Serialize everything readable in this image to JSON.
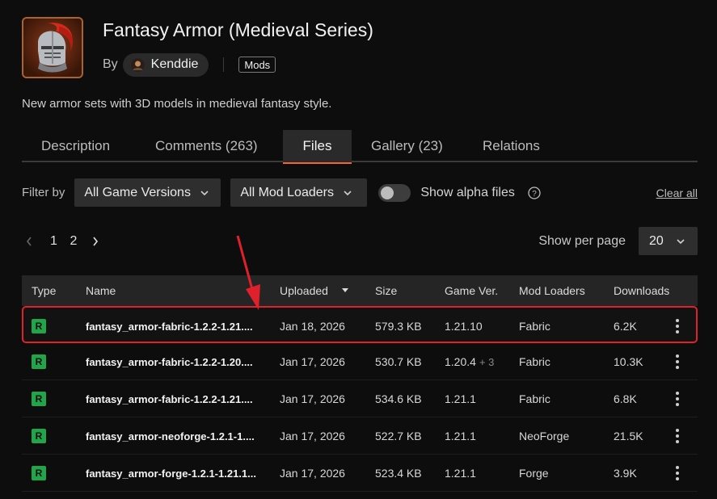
{
  "project": {
    "title": "Fantasy Armor (Medieval Series)",
    "by_label": "By",
    "author": "Kenddie",
    "tag": "Mods",
    "summary": "New armor sets with 3D models in medieval fantasy style."
  },
  "tabs": [
    {
      "label": "Description",
      "active": false
    },
    {
      "label": "Comments (263)",
      "active": false
    },
    {
      "label": "Files",
      "active": true
    },
    {
      "label": "Gallery (23)",
      "active": false
    },
    {
      "label": "Relations",
      "active": false
    }
  ],
  "filters": {
    "label": "Filter by",
    "game_versions": "All Game Versions",
    "mod_loaders": "All Mod Loaders",
    "alpha_label": "Show alpha files",
    "alpha_enabled": false,
    "clear_all": "Clear all"
  },
  "pagination": {
    "pages": [
      "1",
      "2"
    ],
    "current": "1",
    "per_page_label": "Show per page",
    "per_page_value": "20"
  },
  "table": {
    "headers": {
      "type": "Type",
      "name": "Name",
      "uploaded": "Uploaded",
      "size": "Size",
      "game_ver": "Game Ver.",
      "mod_loaders": "Mod Loaders",
      "downloads": "Downloads"
    },
    "rows": [
      {
        "type": "R",
        "name": "fantasy_armor-fabric-1.2.2-1.21....",
        "uploaded": "Jan 18, 2026",
        "size": "579.3 KB",
        "game_ver": "1.21.10",
        "game_ver_more": "",
        "loader": "Fabric",
        "downloads": "6.2K",
        "highlighted": true
      },
      {
        "type": "R",
        "name": "fantasy_armor-fabric-1.2.2-1.20....",
        "uploaded": "Jan 17, 2026",
        "size": "530.7 KB",
        "game_ver": "1.20.4",
        "game_ver_more": "+ 3",
        "loader": "Fabric",
        "downloads": "10.3K",
        "highlighted": false
      },
      {
        "type": "R",
        "name": "fantasy_armor-fabric-1.2.2-1.21....",
        "uploaded": "Jan 17, 2026",
        "size": "534.6 KB",
        "game_ver": "1.21.1",
        "game_ver_more": "",
        "loader": "Fabric",
        "downloads": "6.8K",
        "highlighted": false
      },
      {
        "type": "R",
        "name": "fantasy_armor-neoforge-1.2.1-1....",
        "uploaded": "Jan 17, 2026",
        "size": "522.7 KB",
        "game_ver": "1.21.1",
        "game_ver_more": "",
        "loader": "NeoForge",
        "downloads": "21.5K",
        "highlighted": false
      },
      {
        "type": "R",
        "name": "fantasy_armor-forge-1.2.1-1.21.1...",
        "uploaded": "Jan 17, 2026",
        "size": "523.4 KB",
        "game_ver": "1.21.1",
        "game_ver_more": "",
        "loader": "Forge",
        "downloads": "3.9K",
        "highlighted": false
      }
    ]
  },
  "colors": {
    "accent": "#f16436",
    "release_badge": "#21a54a",
    "highlight_border": "#e0202a"
  }
}
